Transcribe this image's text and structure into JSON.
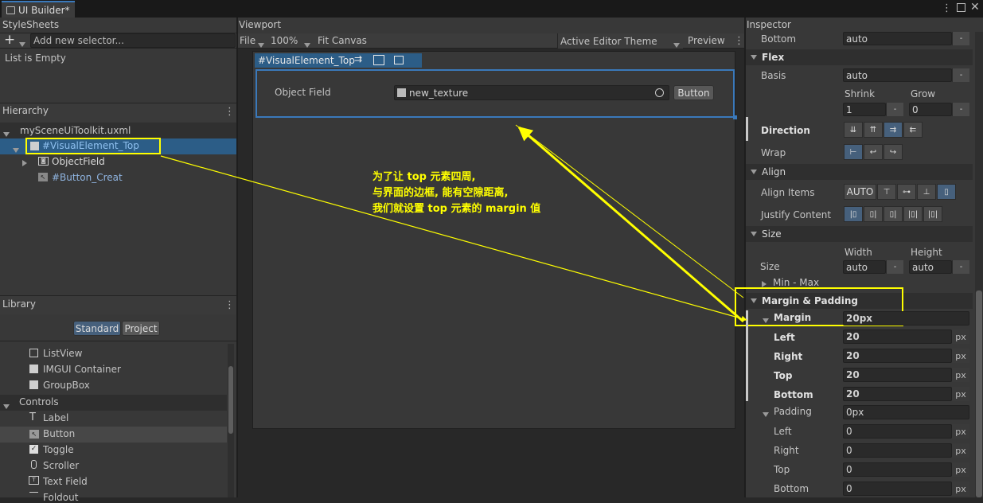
{
  "window": {
    "tab_label": "UI Builder*",
    "menu_icon": "kebab-icon",
    "maximize_icon": "maximize-icon",
    "close_icon": "close-icon"
  },
  "stylesheets": {
    "title": "StyleSheets",
    "add_placeholder": "Add new selector...",
    "empty_text": "List is Empty"
  },
  "hierarchy": {
    "title": "Hierarchy",
    "root": "mySceneUiToolkit.uxml",
    "items": [
      {
        "label": "#VisualElement_Top",
        "selected": true
      },
      {
        "label": "ObjectField"
      },
      {
        "label": "#Button_Creat"
      }
    ]
  },
  "library": {
    "title": "Library",
    "tabs": [
      "Standard",
      "Project"
    ],
    "items_top": [
      "ListView",
      "IMGUI Container",
      "GroupBox"
    ],
    "controls_header": "Controls",
    "controls": [
      "Label",
      "Button",
      "Toggle",
      "Scroller",
      "Text Field",
      "Foldout"
    ]
  },
  "viewport": {
    "title": "Viewport",
    "file": "File",
    "zoom": "100%",
    "fit": "Fit Canvas",
    "theme": "Active Editor Theme",
    "preview": "Preview",
    "element_label": "#VisualElement_Top",
    "object_field_label": "Object Field",
    "object_field_value": "new_texture",
    "button_label": "Button"
  },
  "inspector": {
    "title": "Inspector",
    "bottom_label": "Bottom",
    "bottom_value": "auto",
    "flex_header": "Flex",
    "basis_label": "Basis",
    "basis_value": "auto",
    "shrink_label": "Shrink",
    "shrink_value": "1",
    "grow_label": "Grow",
    "grow_value": "0",
    "direction_label": "Direction",
    "wrap_label": "Wrap",
    "align_header": "Align",
    "align_items_label": "Align Items",
    "align_auto": "AUTO",
    "justify_label": "Justify Content",
    "size_header": "Size",
    "width_label": "Width",
    "height_label": "Height",
    "size_label": "Size",
    "width_value": "auto",
    "height_value": "auto",
    "minmax_label": "Min - Max",
    "mp_header": "Margin & Padding",
    "margin_label": "Margin",
    "margin_value": "20px",
    "margin_rows": [
      {
        "label": "Left",
        "value": "20",
        "unit": "px"
      },
      {
        "label": "Right",
        "value": "20",
        "unit": "px"
      },
      {
        "label": "Top",
        "value": "20",
        "unit": "px"
      },
      {
        "label": "Bottom",
        "value": "20",
        "unit": "px"
      }
    ],
    "padding_label": "Padding",
    "padding_value": "0px",
    "padding_rows": [
      {
        "label": "Left",
        "value": "0",
        "unit": "px"
      },
      {
        "label": "Right",
        "value": "0",
        "unit": "px"
      },
      {
        "label": "Top",
        "value": "0",
        "unit": "px"
      },
      {
        "label": "Bottom",
        "value": "0",
        "unit": "px"
      }
    ],
    "dash": "-"
  },
  "annotation": {
    "line1": "为了让 top 元素四周,",
    "line2": "与界面的边框, 能有空隙距离,",
    "line3": "我们就设置 top 元素的 margin 值"
  },
  "colors": {
    "accent": "#3a79bb",
    "highlight": "#ffff00",
    "selection": "#2c5d87"
  }
}
